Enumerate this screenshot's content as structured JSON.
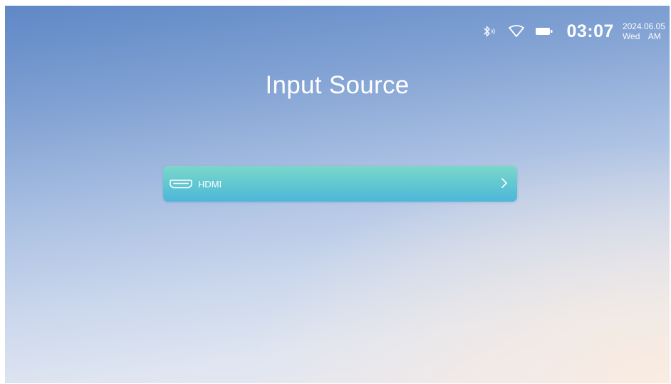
{
  "status_bar": {
    "icons": [
      "bluetooth-icon",
      "wifi-icon",
      "battery-icon"
    ],
    "time": "03:07",
    "date": "2024.06.05",
    "weekday": "Wed",
    "meridiem": "AM"
  },
  "page": {
    "title": "Input Source"
  },
  "sources": [
    {
      "label": "HDMI",
      "icon": "hdmi-icon"
    }
  ],
  "colors": {
    "background_top": "#5f88c6",
    "background_bottom": "#ece9ef",
    "item_gradient_start": "#7cd7c9",
    "item_gradient_end": "#4eb7d9",
    "text": "#ffffff"
  }
}
